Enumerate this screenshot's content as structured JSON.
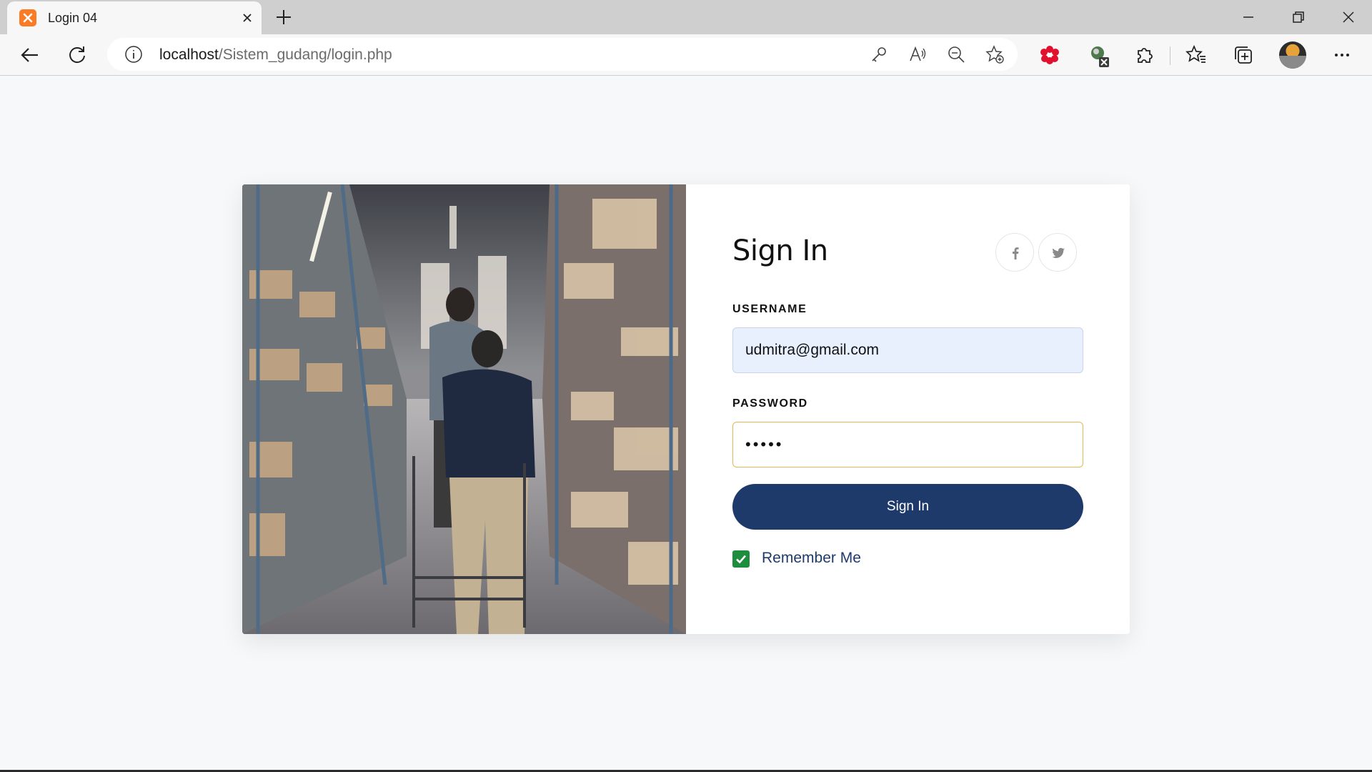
{
  "browser": {
    "tab_title": "Login 04",
    "url_host": "localhost",
    "url_path": "/Sistem_gudang/login.php",
    "icons": [
      "xampp-favicon",
      "close-icon",
      "plus-icon",
      "minimize-icon",
      "restore-icon",
      "window-close-icon",
      "back-icon",
      "refresh-icon",
      "info-icon",
      "key-icon",
      "read-aloud-icon",
      "zoom-out-icon",
      "add-favorite-icon",
      "extension-red-icon",
      "extension-excel-icon",
      "extensions-icon",
      "favorites-icon",
      "collections-icon",
      "profile-avatar",
      "more-icon"
    ]
  },
  "login": {
    "title": "Sign In",
    "social": [
      "facebook-icon",
      "twitter-icon"
    ],
    "username_label": "USERNAME",
    "username_value": "udmitra@gmail.com",
    "password_label": "PASSWORD",
    "password_value": "•••••",
    "submit_label": "Sign In",
    "remember_label": "Remember Me",
    "remember_checked": true
  },
  "colors": {
    "primary": "#1e3a6b",
    "username_bg": "#e8f0fe",
    "password_border": "#e0b857",
    "checkbox": "#1e8e3e",
    "page_bg": "#f7f8fa"
  }
}
